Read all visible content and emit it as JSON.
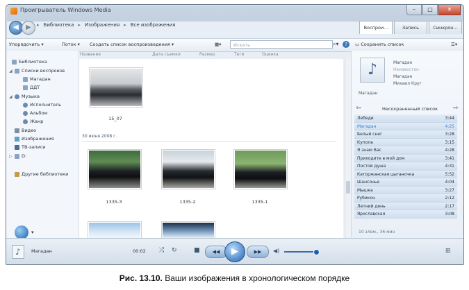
{
  "window": {
    "title": "Проигрыватель Windows Media"
  },
  "address": {
    "crumbs": [
      "Библиотека",
      "Изображения",
      "Все изображения"
    ]
  },
  "tabs": [
    "Воспрои...",
    "Запись",
    "Синхрон..."
  ],
  "toolbar": {
    "organize": "Упорядочить",
    "stream": "Поток",
    "create_playlist": "Создать список воспроизведения",
    "search_placeholder": "Искать",
    "save_list": "Сохранить список"
  },
  "columns": [
    "Название",
    "Дата съемки",
    "Размер",
    "Теги",
    "Оценка"
  ],
  "nav": {
    "library": "Библиотека",
    "playlists": "Списки воспроизв",
    "playlist_items": [
      "Магадан",
      "ДДТ"
    ],
    "music": "Музыка",
    "music_items": [
      "Исполнитель",
      "Альбом",
      "Жанр"
    ],
    "video": "Видео",
    "pictures": "Изображения",
    "tv": "ТВ-записи",
    "drive": "D:",
    "other_libraries": "Другие библиотеки"
  },
  "content": {
    "top_photo_label": "15_07",
    "group_header": "30 июня 2008 г.",
    "photos": [
      "1335-3",
      "1335-2",
      "1335-1"
    ]
  },
  "now_playing": {
    "album_label": "Магадан",
    "lines": [
      "Магадан",
      "Неизвестен",
      "Магадан",
      "Михаил Круг"
    ]
  },
  "playlist": {
    "title": "Несохраненный список",
    "items": [
      {
        "title": "Лебеди",
        "duration": "3:44"
      },
      {
        "title": "Магадан",
        "duration": "4:25"
      },
      {
        "title": "Белый снег",
        "duration": "3:28"
      },
      {
        "title": "Купола",
        "duration": "3:15"
      },
      {
        "title": "Я знаю Вас",
        "duration": "4:28"
      },
      {
        "title": "Приходите в мой дом",
        "duration": "3:41"
      },
      {
        "title": "Постой душа",
        "duration": "4:31"
      },
      {
        "title": "Каторжанская цыганочка",
        "duration": "5:52"
      },
      {
        "title": "Шансонье",
        "duration": "4:04"
      },
      {
        "title": "Мышка",
        "duration": "3:27"
      },
      {
        "title": "Рубикон",
        "duration": "2:12"
      },
      {
        "title": "Летний день",
        "duration": "2:17"
      },
      {
        "title": "Ярославская",
        "duration": "3:08"
      }
    ],
    "footer": "10 элем., 36 мин"
  },
  "player": {
    "song": "Магадан",
    "time": "00:02"
  },
  "caption": {
    "prefix": "Рис. 13.10.",
    "text": "Ваши изображения в хронологическом порядке"
  }
}
